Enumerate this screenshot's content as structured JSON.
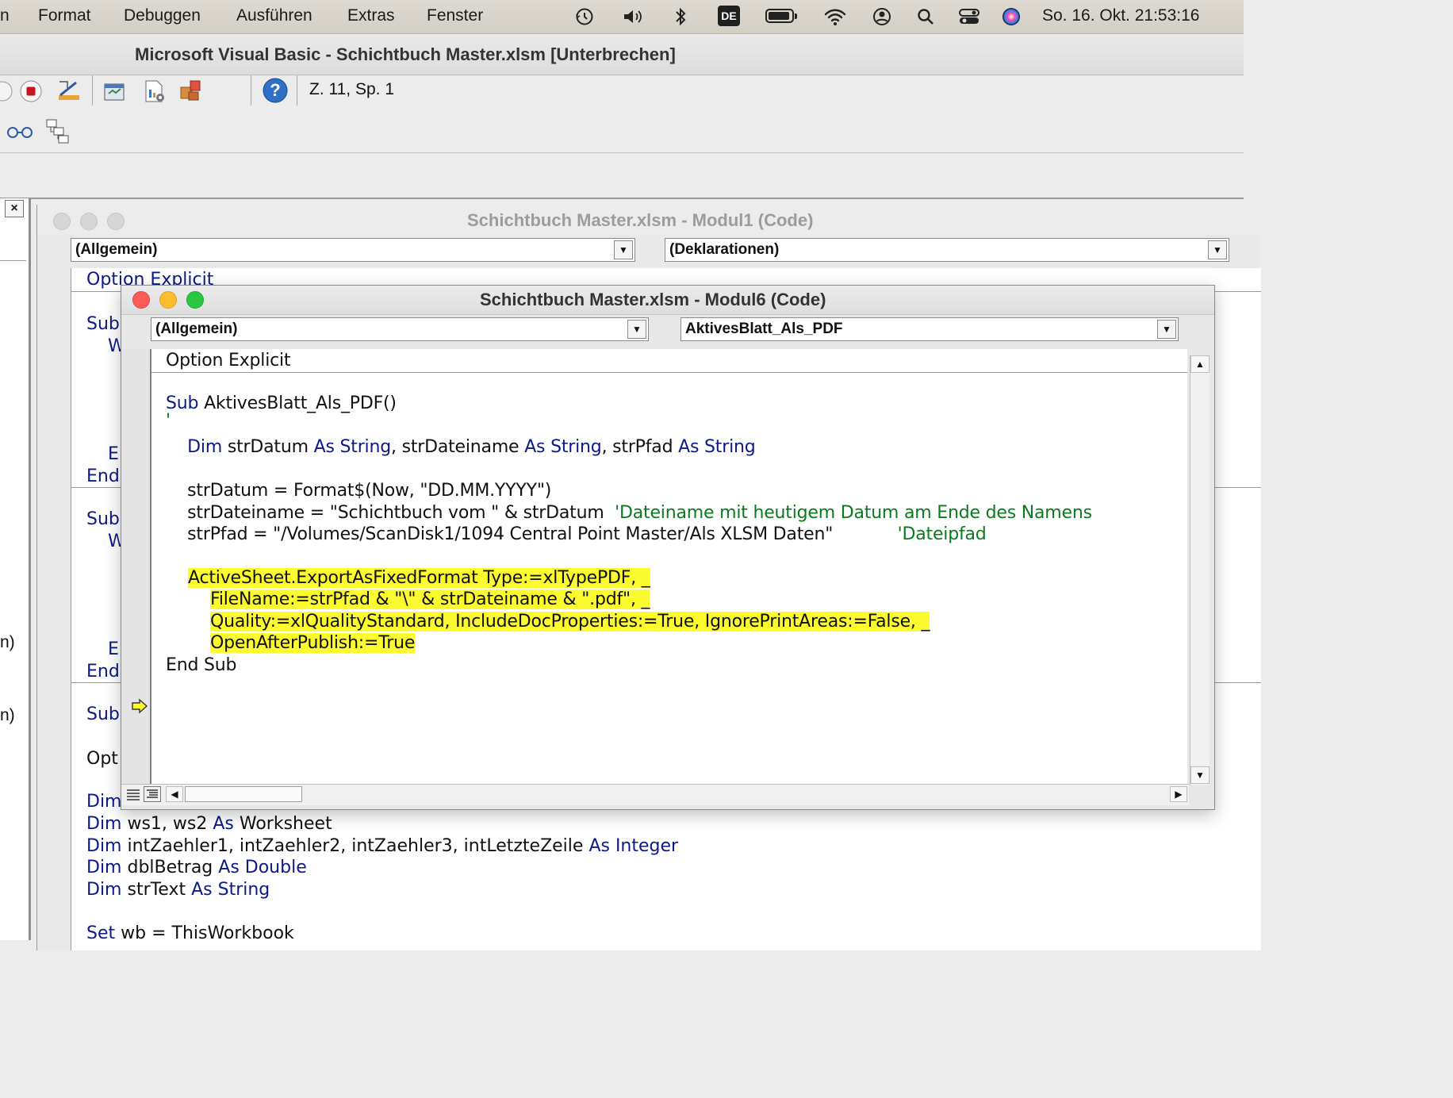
{
  "menubar": {
    "items": [
      "n",
      "Format",
      "Debuggen",
      "Ausführen",
      "Extras",
      "Fenster"
    ],
    "input_source": "DE",
    "clock": "So. 16. Okt.  21:53:16"
  },
  "window": {
    "title": "Microsoft Visual Basic - Schichtbuch Master.xlsm [Unterbrechen]",
    "cursor_position": "Z. 11, Sp. 1"
  },
  "left_pane": {
    "close_label": "×",
    "fragments": [
      "n)",
      "n)"
    ]
  },
  "modul1": {
    "title": "Schichtbuch Master.xlsm - Modul1 (Code)",
    "object_combo": "(Allgemein)",
    "procedure_combo": "(Deklarationen)",
    "lines": {
      "option": "Option Explicit",
      "sub1": "Sub",
      "w1": "W",
      "e1": "E",
      "end1": "End",
      "sub2": "Sub",
      "w2": "W",
      "e2": "E",
      "end2": "End",
      "sub3": "Sub",
      "opt": "Opt",
      "dim0": "Dim",
      "dim1_kw": "Dim",
      "dim1_a": " ws1, ws2 ",
      "dim1_as": "As",
      "dim1_t": " Worksheet",
      "dim2_kw": "Dim",
      "dim2_a": " intZaehler1, intZaehler2, intZaehler3, intLetzteZeile ",
      "dim2_as": "As",
      "dim2_t": " Integer",
      "dim3_kw": "Dim",
      "dim3_a": " dblBetrag ",
      "dim3_as": "As",
      "dim3_t": " Double",
      "dim4_kw": "Dim",
      "dim4_a": " strText ",
      "dim4_as": "As",
      "dim4_t": " String",
      "set_kw": "Set",
      "set_a": " wb = ThisWorkbook"
    }
  },
  "modul6": {
    "title": "Schichtbuch Master.xlsm - Modul6 (Code)",
    "object_combo": "(Allgemein)",
    "procedure_combo": "AktivesBlatt_Als_PDF",
    "code": {
      "l1": "Option Explicit",
      "l2_kw": "Sub",
      "l2_a": " AktivesBlatt_Als_PDF()",
      "l3": "'",
      "l4_kw1": "    Dim",
      "l4_a": " strDatum ",
      "l4_kw2": "As String",
      "l4_b": ", strDateiname ",
      "l4_kw3": "As String",
      "l4_c": ", strPfad ",
      "l4_kw4": "As String",
      "l5_a": "    strDatum = Format$(Now, \"DD.MM.YYYY\")",
      "l6_a": "    strDateiname = \"Schichtbuch vom \" & strDatum  ",
      "l6_cm": "'Dateiname mit heutigem Datum am Ende des Namens",
      "l7_a": "    strPfad = \"/Volumes/ScanDisk1/1094 Central Point Master/Als XLSM Daten\"            ",
      "l7_cm": "'Dateipfad",
      "l8": "ActiveSheet.ExportAsFixedFormat Type:=xlTypePDF, _",
      "l9": "FileName:=strPfad & \"\\\" & strDateiname & \".pdf\", _",
      "l10": "Quality:=xlQualityStandard, IncludeDocProperties:=True, IgnorePrintAreas:=False, _",
      "l11": "OpenAfterPublish:=True",
      "l12": "End Sub"
    }
  },
  "colors": {
    "keyword": "#0a1a8a",
    "comment": "#0b7a1c",
    "highlight": "#fbfb2f"
  }
}
